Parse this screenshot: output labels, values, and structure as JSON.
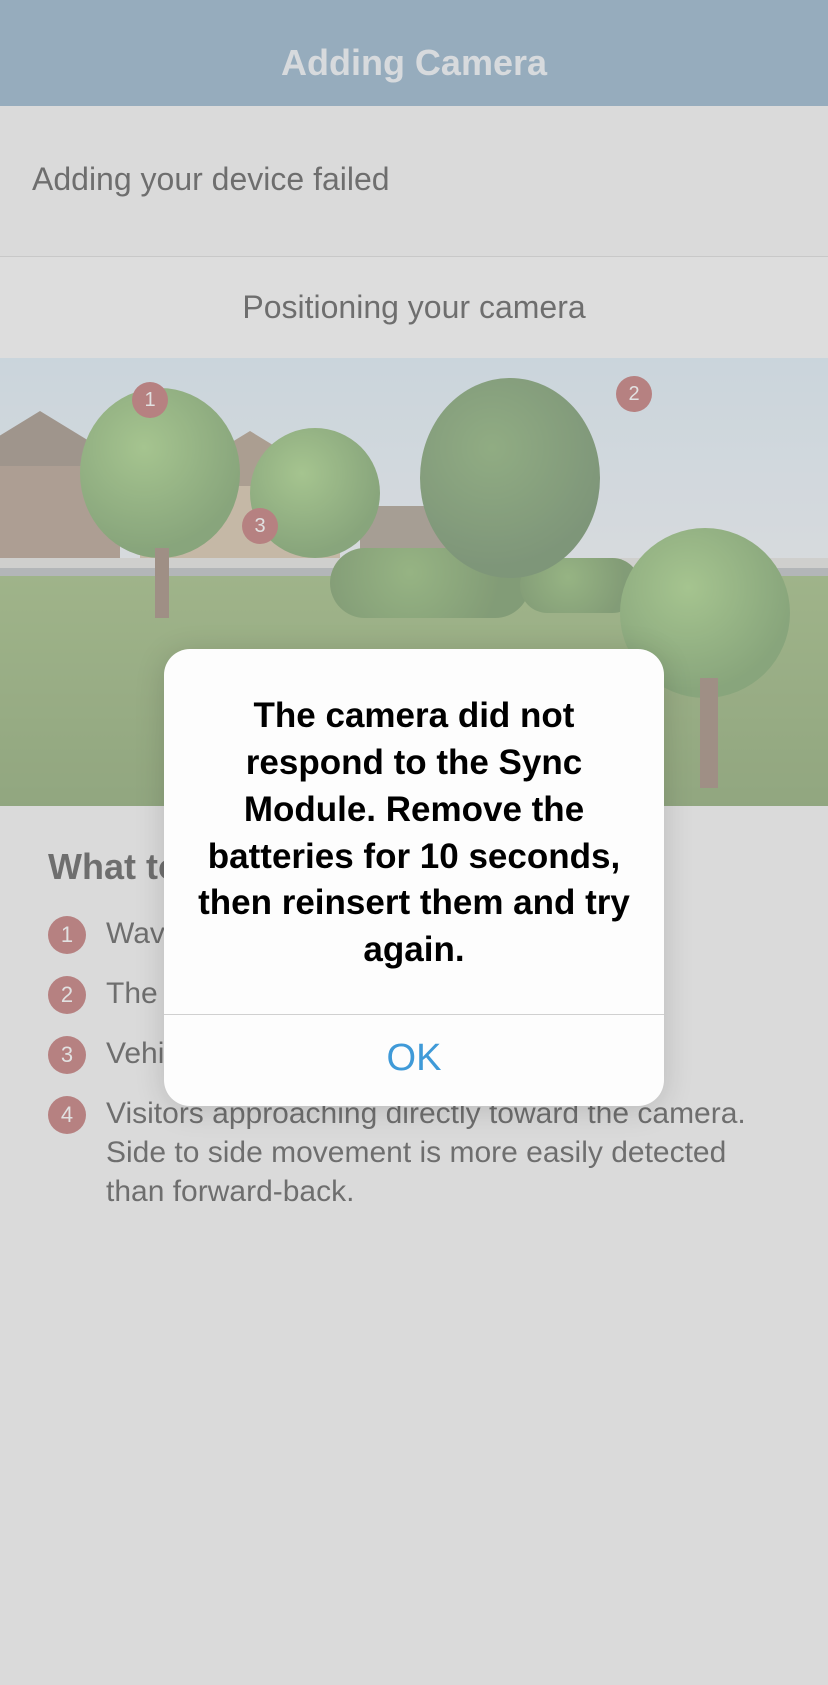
{
  "header": {
    "title": "Adding Camera"
  },
  "status": {
    "message": "Adding your device failed"
  },
  "subtitle": "Positioning your camera",
  "scene_markers": [
    "1",
    "2",
    "3"
  ],
  "avoid": {
    "heading": "What to avoid",
    "items": [
      {
        "n": "1",
        "text": "Waving branches or moving shadows."
      },
      {
        "n": "2",
        "text": "The rising or setting sun."
      },
      {
        "n": "3",
        "text": "Vehicles or pedestrians in the distance."
      },
      {
        "n": "4",
        "text": "Visitors approaching directly toward the camera. Side to side movement is more easily detected than forward-back."
      }
    ]
  },
  "alert": {
    "message": "The camera did not respond to the Sync Module. Remove the batteries for 10 seconds, then reinsert them and try again.",
    "ok": "OK"
  }
}
